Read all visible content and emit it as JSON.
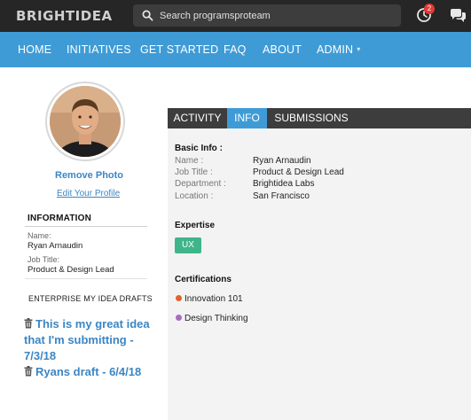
{
  "header": {
    "logo": "BRIGHTIDEA",
    "search_placeholder": "Search programsproteam",
    "notification_count": "2"
  },
  "nav": {
    "items": [
      "HOME",
      "INITIATIVES",
      "GET STARTED",
      "FAQ",
      "ABOUT",
      "ADMIN"
    ],
    "admin_caret": "▾"
  },
  "profile": {
    "remove_photo": "Remove Photo",
    "edit_profile": "Edit Your Profile",
    "information_heading": "INFORMATION",
    "name_label": "Name:",
    "name_value": "Ryan Arnaudin",
    "job_label": "Job Title:",
    "job_value": "Product & Design Lead",
    "drafts_heading": "ENTERPRISE MY IDEA DRAFTS",
    "drafts": [
      "This is my great idea that I'm submitting - 7/3/18",
      "Ryans draft - 6/4/18"
    ]
  },
  "tabs": [
    "ACTIVITY",
    "INFO",
    "SUBMISSIONS"
  ],
  "active_tab": "INFO",
  "info": {
    "basic_heading": "Basic Info :",
    "rows": [
      {
        "label": "Name :",
        "value": "Ryan Arnaudin"
      },
      {
        "label": "Job Title :",
        "value": "Product & Design Lead"
      },
      {
        "label": "Department :",
        "value": "Brightidea Labs"
      },
      {
        "label": "Location :",
        "value": "San Francisco"
      }
    ],
    "expertise_heading": "Expertise",
    "expertise_tag": "UX",
    "certifications_heading": "Certifications",
    "certifications": [
      {
        "name": "Innovation 101",
        "color": "#e0632b"
      },
      {
        "name": "Design Thinking",
        "color": "#a86cc1"
      }
    ]
  },
  "colors": {
    "topbar": "#262626",
    "nav": "#3f9bd6",
    "link": "#3b86c4",
    "tag": "#3fb58a"
  }
}
